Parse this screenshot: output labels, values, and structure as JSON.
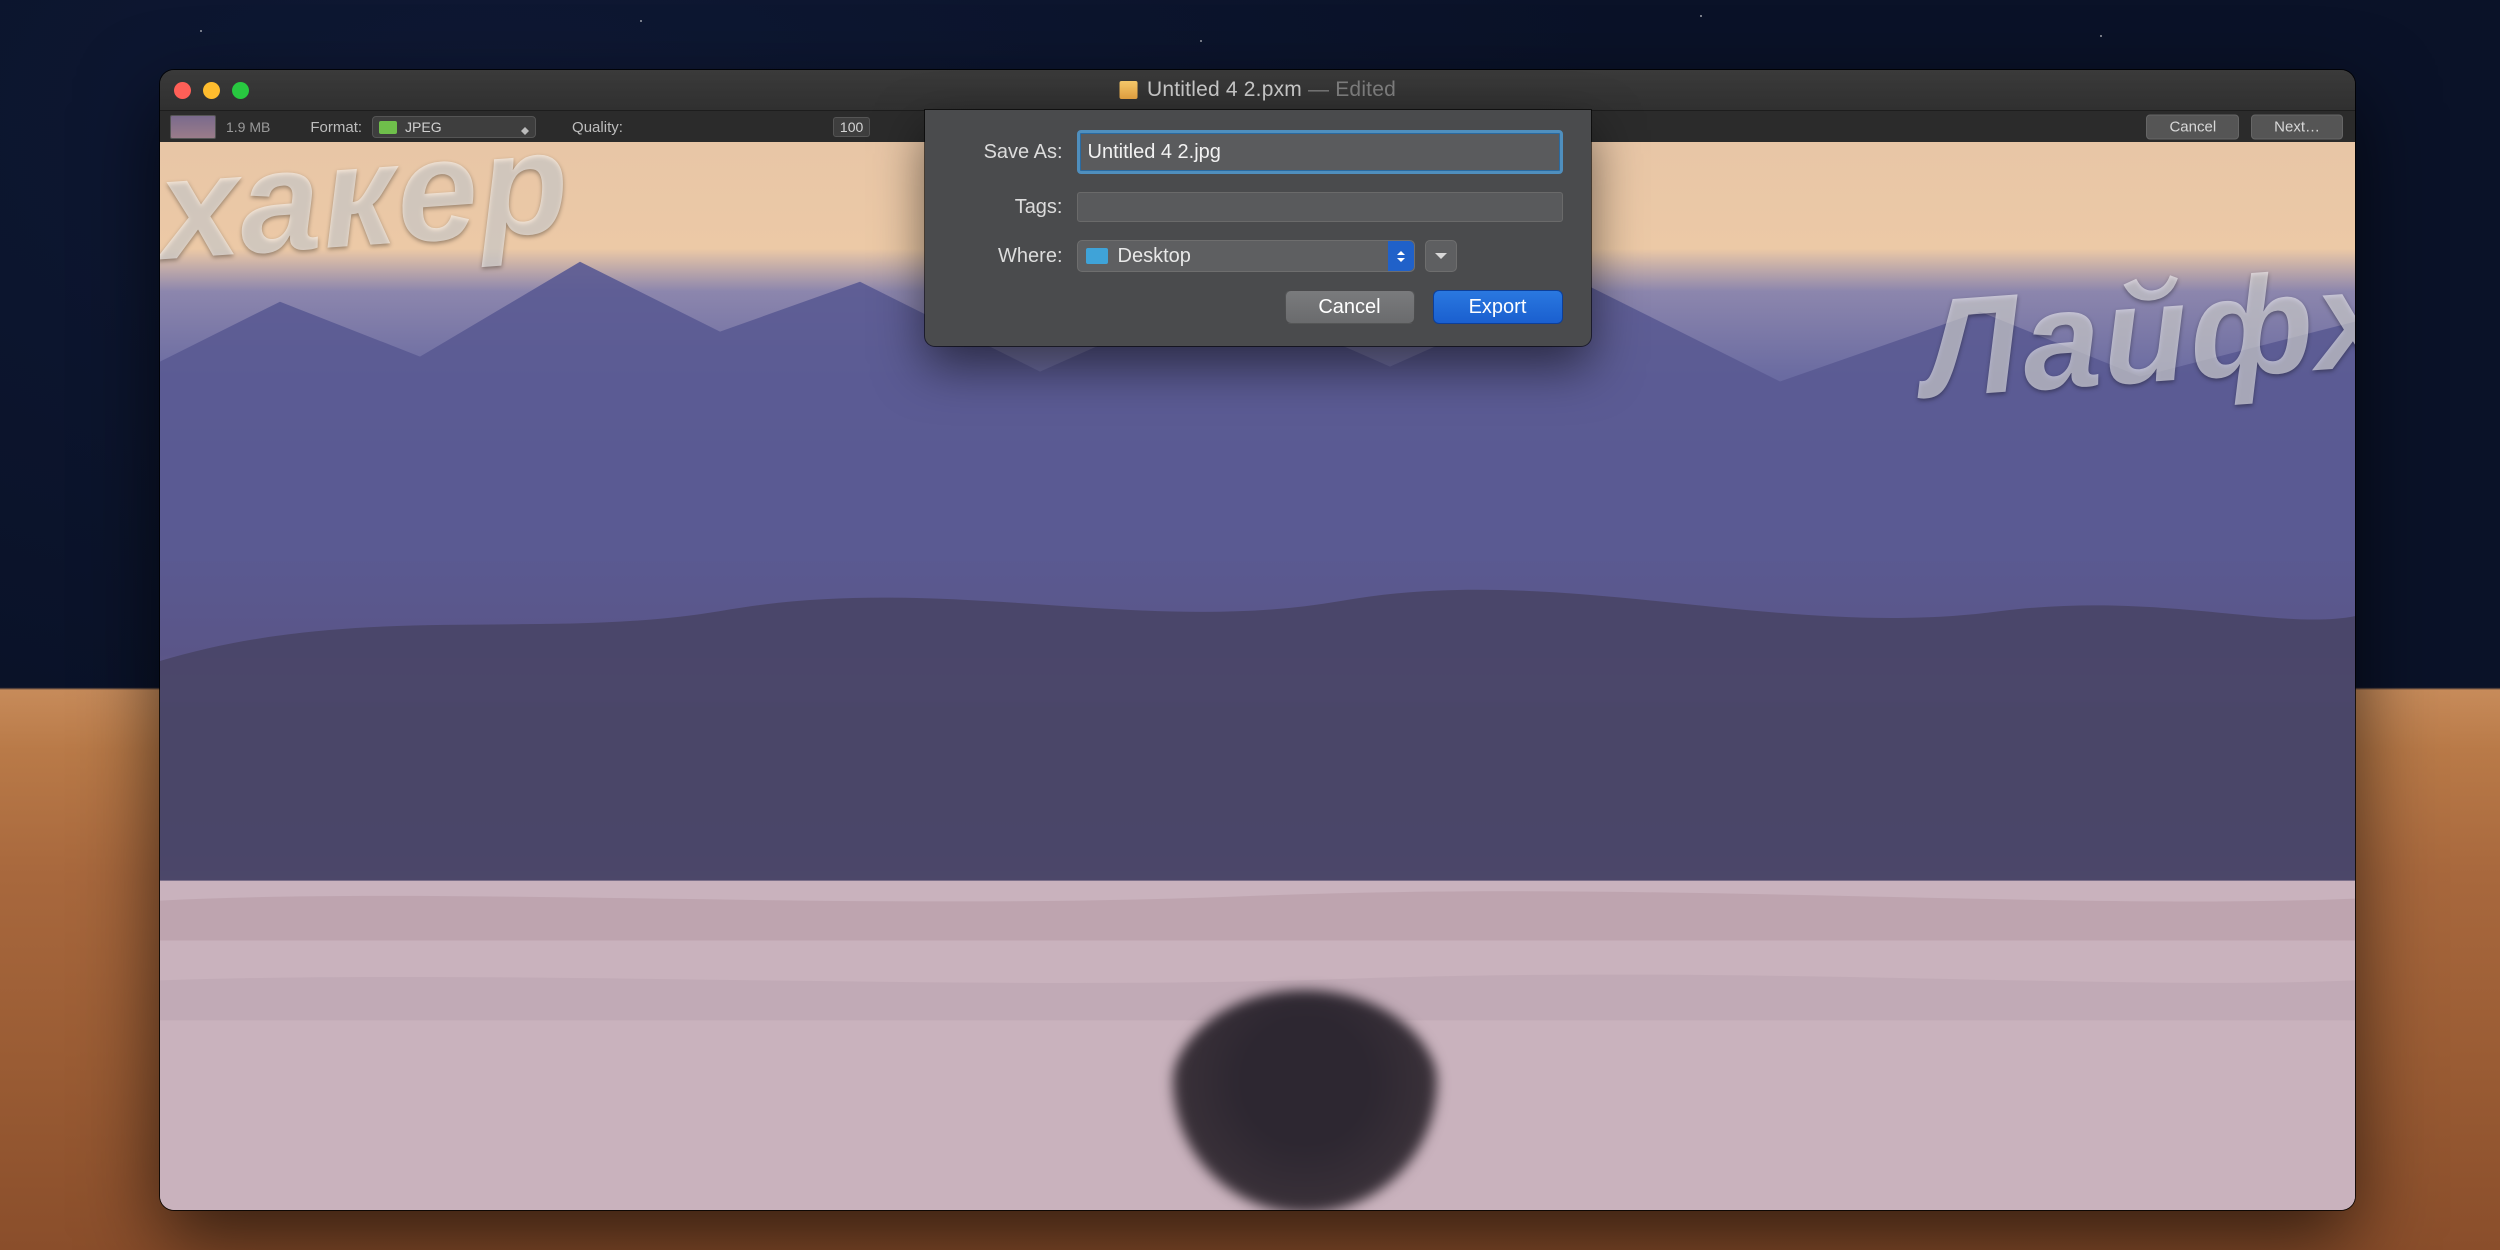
{
  "window": {
    "title_filename": "Untitled 4 2.pxm",
    "title_suffix": " — Edited"
  },
  "toolbar": {
    "filesize": "1.9 MB",
    "format_label": "Format:",
    "format_value": "JPEG",
    "quality_label": "Quality:",
    "quality_value": "100",
    "cancel": "Cancel",
    "next": "Next…"
  },
  "dialog": {
    "saveas_label": "Save As:",
    "saveas_value": "Untitled 4 2.jpg",
    "tags_label": "Tags:",
    "where_label": "Where:",
    "where_value": "Desktop",
    "cancel": "Cancel",
    "export": "Export"
  },
  "watermarks": {
    "left": "хакер",
    "right": "Лайфх"
  }
}
